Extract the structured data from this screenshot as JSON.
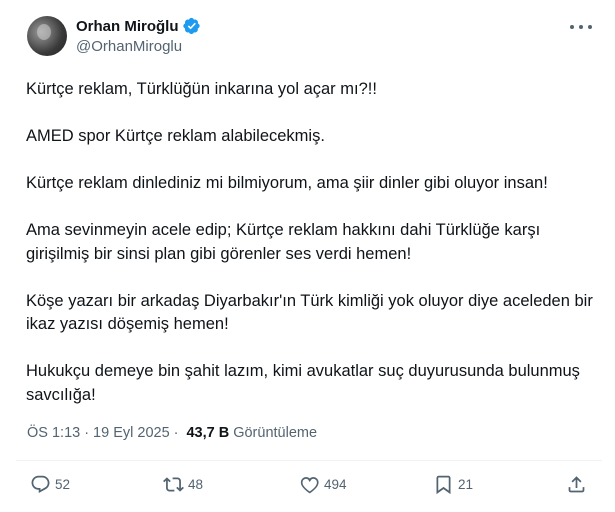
{
  "author": {
    "name": "Orhan Miroğlu",
    "handle": "@OrhanMiroglu",
    "verified_color": "#1d9bf0"
  },
  "tweet": {
    "paragraphs": [
      "Kürtçe reklam, Türklüğün inkarına yol açar mı?!!",
      "AMED spor Kürtçe reklam alabilecekmiş.",
      "Kürtçe reklam dinlediniz mi bilmiyorum, ama şiir dinler gibi oluyor insan!",
      "Ama sevinmeyin acele edip; Kürtçe reklam hakkını  dahi Türklüğe karşı girişilmiş bir sinsi plan gibi görenler ses verdi hemen!",
      "Köşe yazarı bir arkadaş Diyarbakır'ın Türk kimliği yok oluyor diye aceleden bir ikaz yazısı döşemiş hemen!",
      "Hukukçu demeye bin şahit lazım, kimi avukatlar suç duyurusunda bulunmuş savcılığa!"
    ]
  },
  "meta": {
    "time": "ÖS 1:13",
    "separator": "·",
    "date": "19 Eyl 2025",
    "views_count": "43,7 B",
    "views_label": "Görüntüleme"
  },
  "actions": {
    "replies": "52",
    "reposts": "48",
    "likes": "494",
    "bookmarks": "21"
  },
  "icons": [
    "more-icon",
    "verified-icon",
    "reply-icon",
    "repost-icon",
    "like-icon",
    "bookmark-icon",
    "share-icon"
  ]
}
